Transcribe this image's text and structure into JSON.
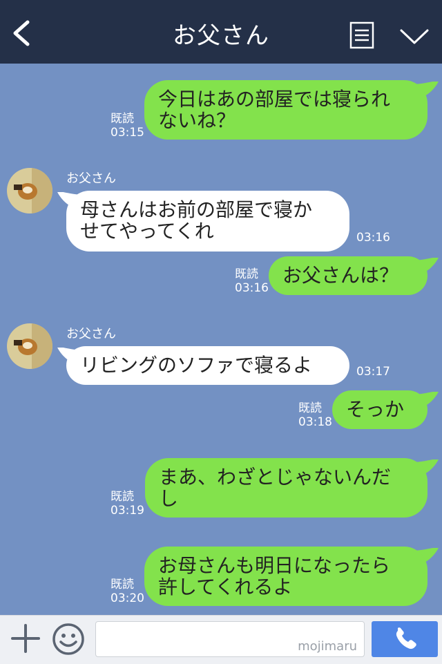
{
  "header": {
    "title": "お父さん",
    "back_icon": "chevron-left-icon",
    "menu_icon": "menu-list-icon",
    "collapse_icon": "chevron-down-icon",
    "bg_color": "#243048"
  },
  "chat": {
    "bg_color": "#7391c3",
    "outgoing_color": "#83e24c",
    "incoming_color": "#ffffff",
    "messages": [
      {
        "dir": "out",
        "lines": [
          "今日はあの部屋では寝られ",
          "ないね？"
        ],
        "read": "既読",
        "time": "03:15"
      },
      {
        "dir": "in",
        "sender": "お父さん",
        "lines": [
          "母さんはお前の部屋で寝か",
          "せてやってくれ"
        ],
        "time": "03:16"
      },
      {
        "dir": "out",
        "lines": [
          "お父さんは？"
        ],
        "read": "既読",
        "time": "03:16"
      },
      {
        "dir": "in",
        "sender": "お父さん",
        "lines": [
          "リビングのソファで寝るよ"
        ],
        "time": "03:17"
      },
      {
        "dir": "out",
        "lines": [
          "そっか"
        ],
        "read": "既読",
        "time": "03:18"
      },
      {
        "dir": "out",
        "lines": [
          "まあ、わざとじゃないんだ",
          "し"
        ],
        "read": "既読",
        "time": "03:19"
      },
      {
        "dir": "out",
        "lines": [
          "お母さんも明日になったら",
          "許してくれるよ"
        ],
        "read": "既読",
        "time": "03:20"
      }
    ]
  },
  "input_bar": {
    "placeholder": "",
    "watermark": "mojimaru",
    "plus_icon": "plus-icon",
    "emoji_icon": "smile-icon",
    "send_icon": "phone-icon",
    "send_color": "#4f86e6"
  }
}
